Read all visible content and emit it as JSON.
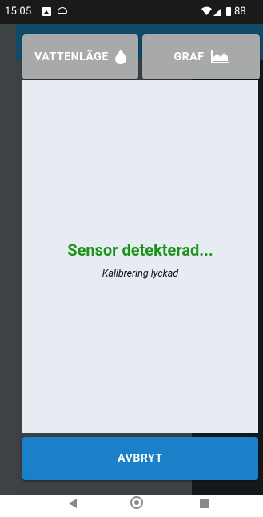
{
  "status_bar": {
    "time": "15:05",
    "battery": "88"
  },
  "dialog": {
    "tabs": [
      {
        "label": "VATTENLÄGE",
        "icon": "water-drop-icon"
      },
      {
        "label": "GRAF",
        "icon": "area-chart-icon"
      }
    ],
    "title": "Sensor detekterad...",
    "subtitle": "Kalibrering lyckad",
    "cancel_label": "AVBRYT"
  },
  "colors": {
    "title_green": "#1a9317",
    "cancel_blue": "#1a80c8",
    "tab_gray": "#a7a9aa",
    "panel_bg": "#e6ecf2"
  },
  "nav_bar": {
    "icons": [
      "back-icon",
      "home-icon",
      "recents-icon"
    ]
  }
}
